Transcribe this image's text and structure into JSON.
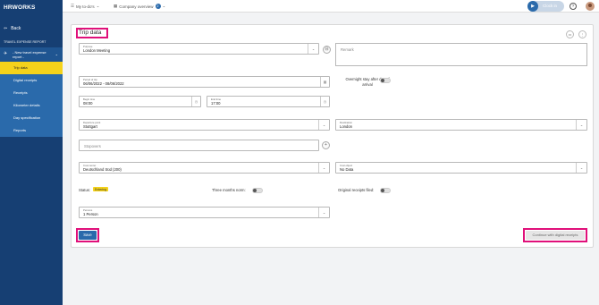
{
  "sidebar": {
    "logo": "HRWORKS",
    "back_label": "Back",
    "section_title": "TRAVEL EXPENSE REPORT",
    "report_label": "- New travel expense report -",
    "items": [
      {
        "label": "Trip data",
        "active": true
      },
      {
        "label": "Digital receipts",
        "active": false
      },
      {
        "label": "Receipts",
        "active": false
      },
      {
        "label": "Kilometer details",
        "active": false
      },
      {
        "label": "Day specification",
        "active": false
      },
      {
        "label": "Reports",
        "active": false
      }
    ]
  },
  "topbar": {
    "todo_label": "My to-do's",
    "company_label": "Company overview",
    "company_badge": "2",
    "clockin_label": "Clock in",
    "help_label": "?"
  },
  "form": {
    "title": "Trip data",
    "purpose_label": "Purpose",
    "purpose_value": "London Meeting",
    "remark_placeholder": "Remark",
    "period_label": "Period of trip",
    "period_value": "06/06/2022 - 08/06/2022",
    "overnight_label": "Overnight stay after day of arrival",
    "begin_label": "Begin time",
    "begin_value": "08:00",
    "end_label": "End time",
    "end_value": "17:00",
    "departure_label": "Departure point",
    "departure_value": "Stuttgart",
    "destination_label": "Destination",
    "destination_value": "London",
    "stopovers_placeholder": "Stopovers",
    "cost_center_label": "Cost center",
    "cost_center_value": "Deutschland Süd (200)",
    "cost_object_label": "Cost object",
    "cost_object_value": "No Data",
    "status_label": "Status:",
    "status_value": "Entering",
    "three_months_label": "Three months norm:",
    "original_receipts_label": "Original receipts filed:",
    "persons_label": "Persons",
    "persons_value": "1 Person",
    "save_label": "Save",
    "continue_label": "Continue with digital receipts"
  },
  "colors": {
    "sidebar_bg": "#163f73",
    "accent_blue": "#2a6aab",
    "active_yellow": "#f4d21b",
    "highlight_magenta": "#e0107a"
  }
}
